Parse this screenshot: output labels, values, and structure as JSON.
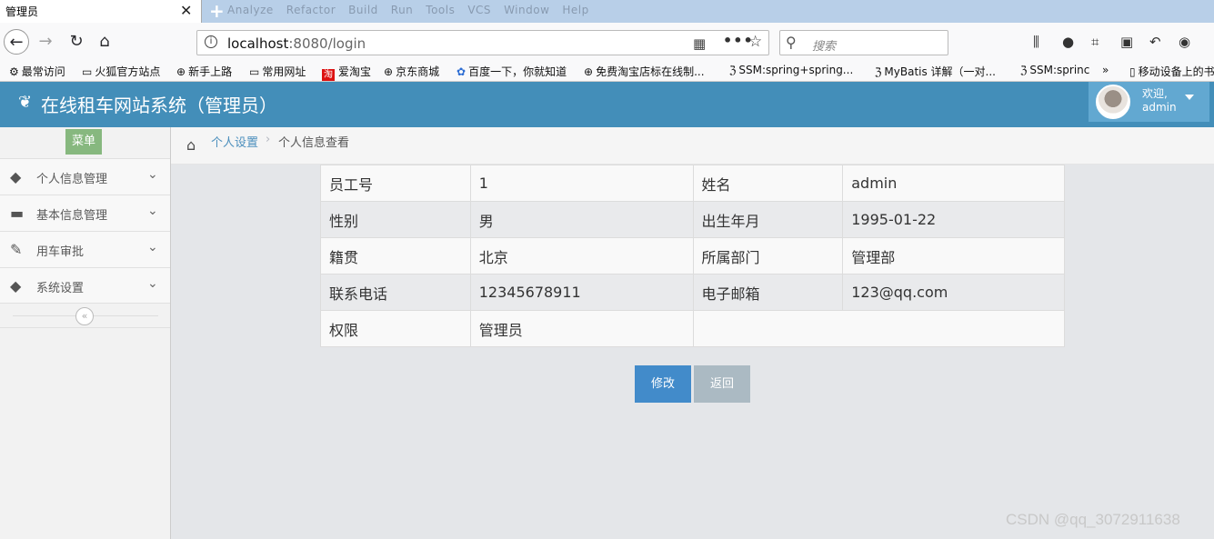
{
  "browser": {
    "tab_title": "管理员",
    "tab_close": "✕",
    "new_tab": "+",
    "ghost_menu": [
      "Analyze",
      "Refactor",
      "Build",
      "Run",
      "Tools",
      "VCS",
      "Window",
      "Help"
    ],
    "url_host": "localhost",
    "url_rest": ":8080/login",
    "search_placeholder": "搜索",
    "bookmarks": [
      {
        "icon": "gear-icon",
        "label": "最常访问"
      },
      {
        "icon": "folder-icon",
        "label": "火狐官方站点"
      },
      {
        "icon": "globe-icon",
        "label": "新手上路"
      },
      {
        "icon": "folder-icon",
        "label": "常用网址"
      },
      {
        "icon": "taobao-icon",
        "label": "爱淘宝"
      },
      {
        "icon": "globe-icon",
        "label": "京东商城"
      },
      {
        "icon": "baidu-icon",
        "label": "百度一下，你就知道"
      },
      {
        "icon": "globe-icon",
        "label": "免费淘宝店标在线制..."
      },
      {
        "icon": "csdn-icon",
        "label": "SSM:spring+spring..."
      },
      {
        "icon": "csdn-icon",
        "label": "MyBatis 详解（一对..."
      },
      {
        "icon": "csdn-icon",
        "label": "SSM:sprinc"
      },
      {
        "icon": "mobile-icon",
        "label": "移动设备上的书"
      }
    ]
  },
  "app": {
    "title": "在线租车网站系统（管理员）",
    "user": {
      "welcome": "欢迎,",
      "name": "admin"
    }
  },
  "sidebar": {
    "menu_label": "菜单",
    "items": [
      {
        "label": "个人信息管理",
        "icon": "tag-icon"
      },
      {
        "label": "基本信息管理",
        "icon": "desktop-icon"
      },
      {
        "label": "用车审批",
        "icon": "edit-icon"
      },
      {
        "label": "系统设置",
        "icon": "tag-icon"
      }
    ],
    "collapse_glyph": "«"
  },
  "breadcrumb": {
    "items": [
      "个人设置",
      "个人信息查看"
    ]
  },
  "profile": {
    "rows": [
      [
        {
          "label": "员工号",
          "value": "1"
        },
        {
          "label": "姓名",
          "value": "admin"
        }
      ],
      [
        {
          "label": "性别",
          "value": "男"
        },
        {
          "label": "出生年月",
          "value": "1995-01-22"
        }
      ],
      [
        {
          "label": "籍贯",
          "value": "北京"
        },
        {
          "label": "所属部门",
          "value": "管理部"
        }
      ],
      [
        {
          "label": "联系电话",
          "value": "12345678911"
        },
        {
          "label": "电子邮箱",
          "value": "123@qq.com"
        }
      ],
      [
        {
          "label": "权限",
          "value": "管理员"
        }
      ]
    ]
  },
  "buttons": {
    "edit": "修改",
    "back": "返回"
  },
  "watermark": "CSDN @qq_3072911638",
  "colors": {
    "header": "#438eb9",
    "edit_button": "#428bca",
    "back_button": "#abbac3",
    "menu_tag": "#87b87f"
  }
}
